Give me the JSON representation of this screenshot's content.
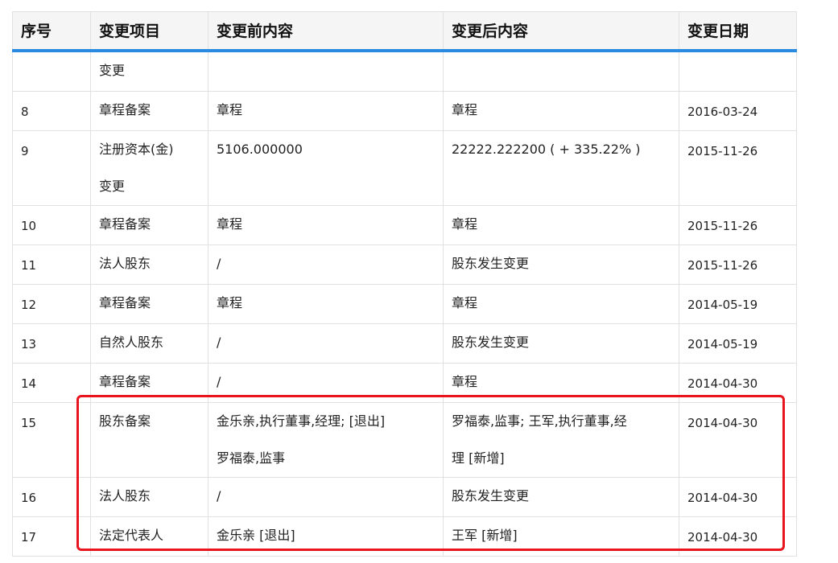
{
  "table": {
    "headers": [
      "序号",
      "变更项目",
      "变更前内容",
      "变更后内容",
      "变更日期"
    ],
    "rows": [
      {
        "no": "",
        "item": [
          "变更"
        ],
        "before": [
          ""
        ],
        "after": [
          ""
        ],
        "date": ""
      },
      {
        "no": "8",
        "item": [
          "章程备案"
        ],
        "before": [
          "章程"
        ],
        "after": [
          "章程"
        ],
        "date": "2016-03-24"
      },
      {
        "no": "9",
        "item": [
          "注册资本(金)",
          "变更"
        ],
        "before": [
          "5106.000000"
        ],
        "after": [
          "22222.222200 ( + 335.22% )"
        ],
        "date": "2015-11-26"
      },
      {
        "no": "10",
        "item": [
          "章程备案"
        ],
        "before": [
          "章程"
        ],
        "after": [
          "章程"
        ],
        "date": "2015-11-26"
      },
      {
        "no": "11",
        "item": [
          "法人股东"
        ],
        "before": [
          "/"
        ],
        "after": [
          "股东发生变更"
        ],
        "date": "2015-11-26"
      },
      {
        "no": "12",
        "item": [
          "章程备案"
        ],
        "before": [
          "章程"
        ],
        "after": [
          "章程"
        ],
        "date": "2014-05-19"
      },
      {
        "no": "13",
        "item": [
          "自然人股东"
        ],
        "before": [
          "/"
        ],
        "after": [
          "股东发生变更"
        ],
        "date": "2014-05-19"
      },
      {
        "no": "14",
        "item": [
          "章程备案"
        ],
        "before": [
          "/"
        ],
        "after": [
          "章程"
        ],
        "date": "2014-04-30"
      },
      {
        "no": "15",
        "item": [
          "股东备案"
        ],
        "before": [
          "金乐亲,执行董事,经理; [退出]",
          "罗福泰,监事"
        ],
        "after": [
          "罗福泰,监事; 王军,执行董事,经",
          "理 [新增]"
        ],
        "date": "2014-04-30"
      },
      {
        "no": "16",
        "item": [
          "法人股东"
        ],
        "before": [
          "/"
        ],
        "after": [
          "股东发生变更"
        ],
        "date": "2014-04-30"
      },
      {
        "no": "17",
        "item": [
          "法定代表人"
        ],
        "before": [
          "金乐亲 [退出]"
        ],
        "after": [
          "王军 [新增]"
        ],
        "date": "2014-04-30"
      }
    ]
  },
  "highlight_color": "#e8141e",
  "header_accent_color": "#2a8ae0"
}
